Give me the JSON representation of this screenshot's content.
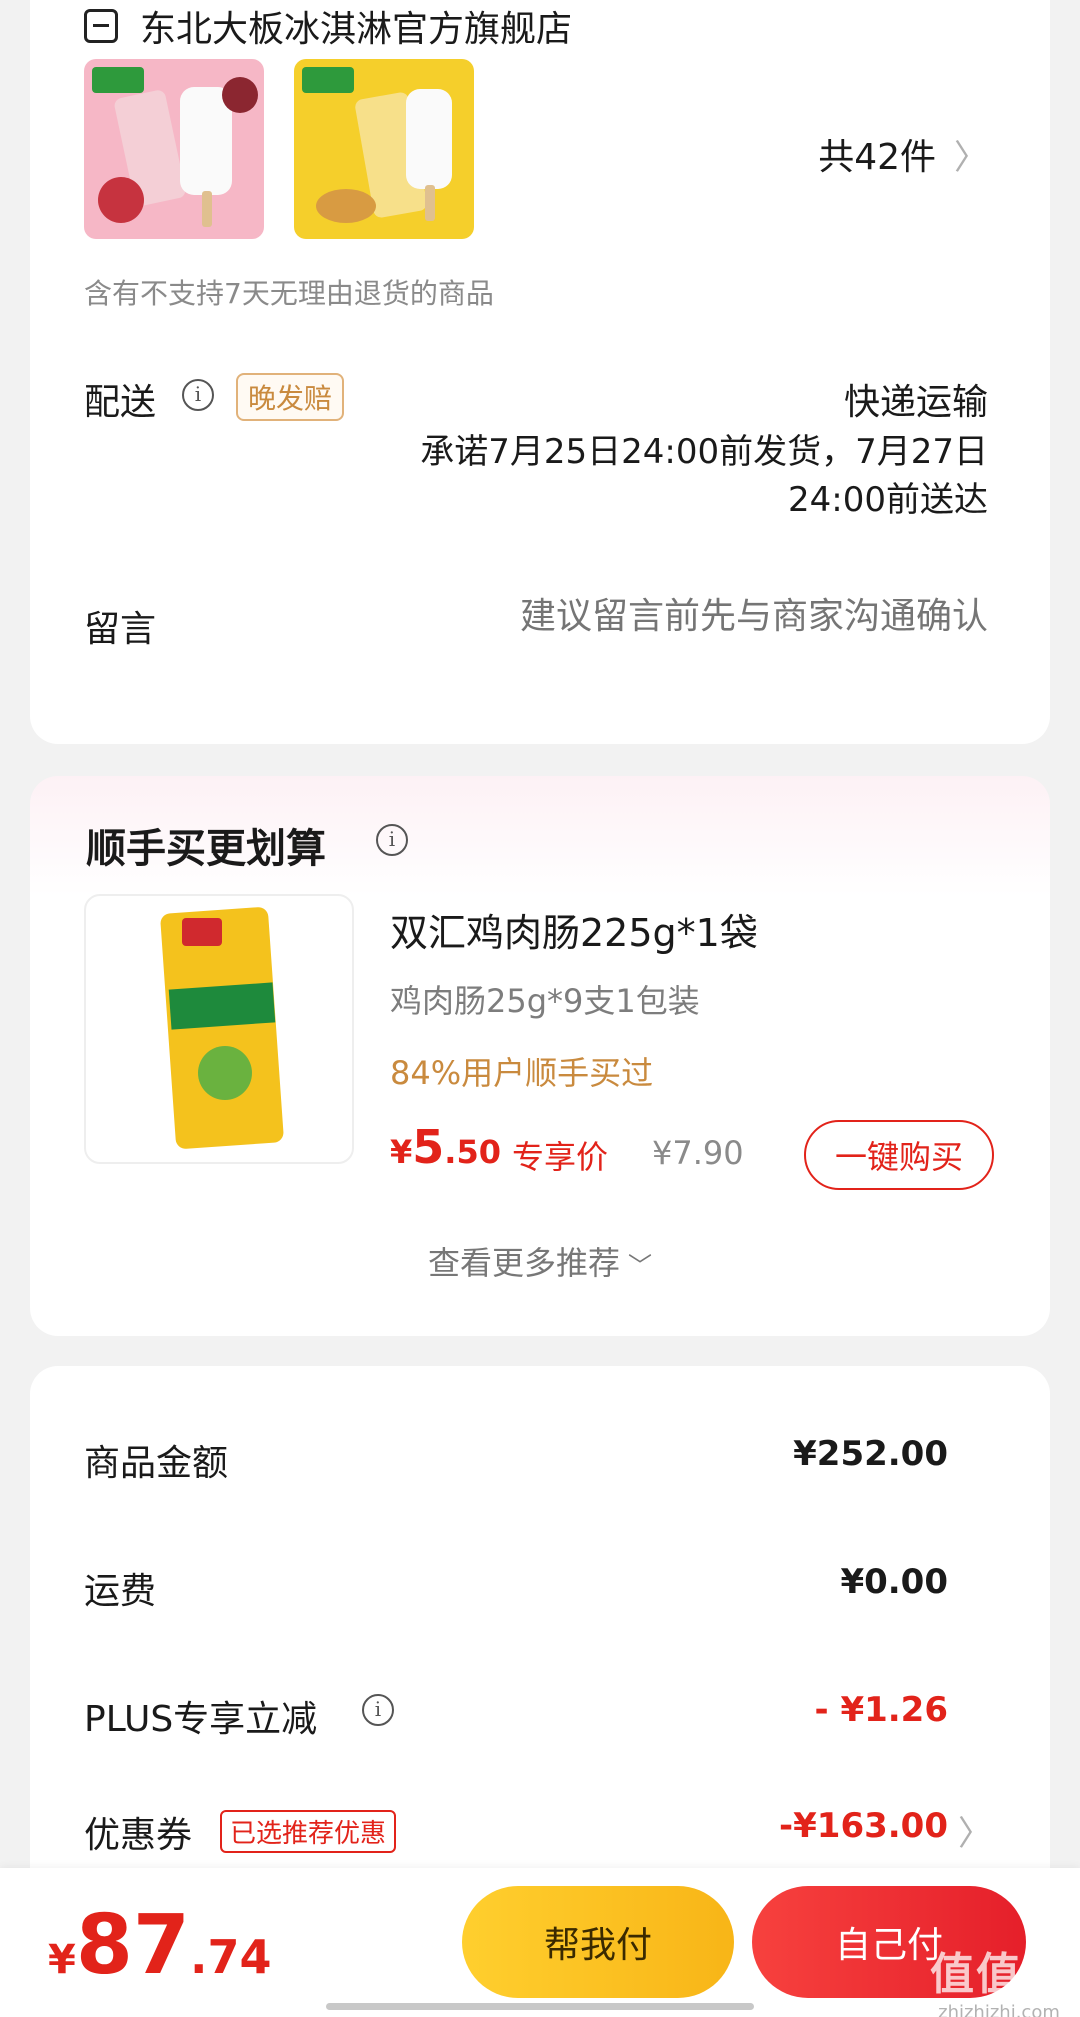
{
  "store": {
    "name": "东北大板冰淇淋官方旗舰店",
    "item_count": "共42件",
    "return_note": "含有不支持7天无理由退货的商品",
    "delivery": {
      "label": "配送",
      "badge": "晚发赔",
      "method": "快递运输",
      "promise": "承诺7月25日24:00前发货，7月27日24:00前送达"
    },
    "message": {
      "label": "留言",
      "placeholder": "建议留言前先与商家沟通确认"
    }
  },
  "addon": {
    "section_title": "顺手买更划算",
    "product": {
      "name": "双汇鸡肉肠225g*1袋",
      "spec": "鸡肉肠25g*9支1包装",
      "social_proof": "84%用户顺手买过",
      "price_symbol": "¥",
      "price_int": "5",
      "price_dec": ".50",
      "price_tag": "专享价",
      "original_price": "¥7.90",
      "buy_label": "一键购买"
    },
    "more_label": "查看更多推荐"
  },
  "summary": {
    "goods_label": "商品金额",
    "goods_value": "¥252.00",
    "shipping_label": "运费",
    "shipping_value": "¥0.00",
    "plus_label": "PLUS专享立减",
    "plus_value": "- ¥1.26",
    "coupon_label": "优惠券",
    "coupon_badge": "已选推荐优惠",
    "coupon_value": "-¥163.00"
  },
  "bottom": {
    "total_symbol": "¥",
    "total_int": "87",
    "total_dec": ".74",
    "help_pay_label": "帮我付",
    "self_pay_label": "自己付"
  },
  "watermark": {
    "logo": "值值值",
    "url": "zhizhizhi.com"
  },
  "icons": {
    "store": "store-icon",
    "info": "info-icon",
    "chevron_right": "chevron-right-icon",
    "chevron_down": "chevron-down-icon"
  },
  "colors": {
    "accent_red": "#e2231a",
    "accent_orange": "#c98a3e",
    "pay_yellow": "#f8b517",
    "background": "#f2f2f2"
  }
}
